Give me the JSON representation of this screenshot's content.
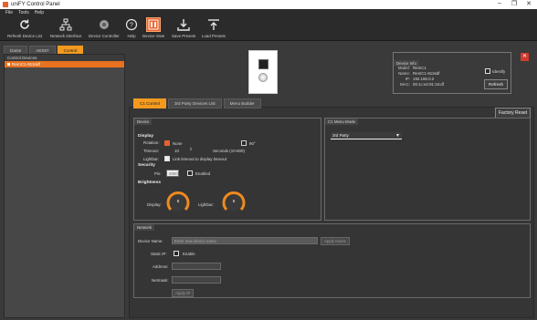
{
  "window": {
    "title": "uniFY Control Panel",
    "controls": [
      "–",
      "❐",
      "✕"
    ]
  },
  "menu": [
    "File",
    "Tools",
    "Help"
  ],
  "toolbar": [
    {
      "label": "Refresh Device List",
      "icon": "refresh-icon"
    },
    {
      "label": "Network Interface",
      "icon": "network-icon"
    },
    {
      "label": "Device Controller",
      "icon": "controller-icon"
    },
    {
      "label": "Help",
      "icon": "help-icon"
    },
    {
      "label": "Device View",
      "icon": "device-view-icon"
    },
    {
      "label": "Save Presets",
      "icon": "save-icon"
    },
    {
      "label": "Load Presets",
      "icon": "load-icon"
    }
  ],
  "left": {
    "tabs": [
      "Dante",
      "AES67",
      "Control"
    ],
    "header": "Control Devices",
    "device": "RemC1-9116df"
  },
  "device_info": {
    "header": "Device Info",
    "rows": [
      {
        "k": "Model:",
        "v": "RemC1"
      },
      {
        "k": "Name:",
        "v": "RemC1-9116df"
      },
      {
        "k": "IP:",
        "v": "192.168.0.2"
      },
      {
        "k": "MAC:",
        "v": "00:1c:e2:91:16:df"
      }
    ],
    "identify": "Identify",
    "refresh": "Refresh"
  },
  "center_tabs": [
    "C1 Control",
    "3rd Party Devices List",
    "Menu Builder"
  ],
  "factory_reset": "Factory Reset",
  "device_section": {
    "header": "Device",
    "display": "Display",
    "rotation": "Rotation:",
    "none": "None",
    "r90": "90°",
    "timeout": "Timeout:",
    "timeout_value": "10",
    "seconds": "Seconds (10-600)",
    "lightbar": "Lightbar:",
    "link_timeout": "Link timeout to display timeout",
    "security": "Security",
    "pin": "Pin:",
    "pin_value": "0000",
    "enabled": "Enabled",
    "brightness": "Brightness",
    "display_label": "Display:",
    "display_level": "5",
    "lightbar_label": "Lightbar:",
    "lightbar_level": "5"
  },
  "menu_mode": {
    "header": "C1 Menu Mode",
    "selected": "3rd Party"
  },
  "network": {
    "header": "Network",
    "device_name": "Device Name:",
    "device_name_placeholder": "Enter new device name",
    "apply_name": "Apply Name",
    "static_ip": "Static IP:",
    "enable": "Enable",
    "address": "Address:",
    "netmask": "Netmask:",
    "apply_ip": "Apply IP"
  },
  "colors": {
    "accent": "#f39a1e",
    "selection": "#e87220",
    "gauge": "#f08a1e"
  }
}
